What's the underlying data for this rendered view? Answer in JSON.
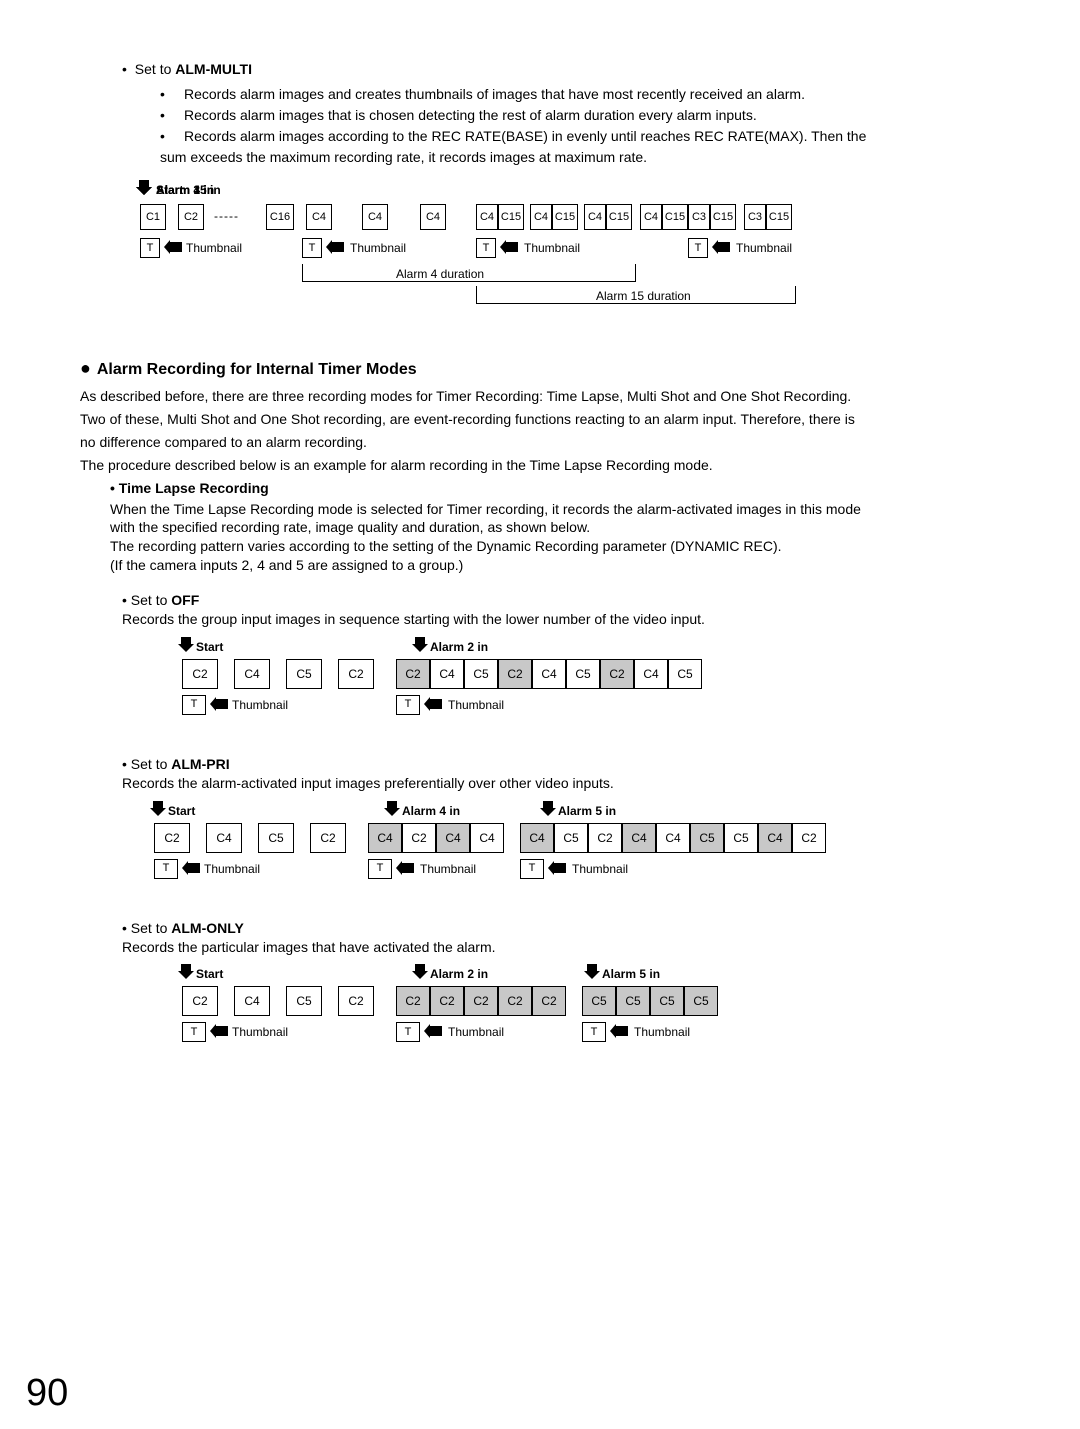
{
  "page_number": "90",
  "alm_multi": {
    "lead_prefix": "Set to ",
    "lead_bold": "ALM-MULTI",
    "bullets": [
      "Records alarm images and creates thumbnails of images that have most recently received an alarm.",
      "Records alarm images that is chosen detecting the rest of alarm duration every alarm inputs.",
      "Records alarm images according to the REC RATE(BASE) in evenly until reaches REC RATE(MAX). Then the"
    ],
    "sum_line": "sum exceeds the maximum recording rate, it records images at maximum rate."
  },
  "d1": {
    "events": [
      "Start",
      "Alarm 4 in",
      "Alarm 15 in",
      "Alarm 3 in"
    ],
    "row1_cells": [
      "C1",
      "C2",
      "C16",
      "C4",
      "C4",
      "C4",
      "C4",
      "C15",
      "C4",
      "C15",
      "C4",
      "C15",
      "C4",
      "C15",
      "C3",
      "C15",
      "C3",
      "C15"
    ],
    "t_label": "T",
    "thumbnail": "Thumbnail",
    "alarm4_dur": "Alarm 4 duration",
    "alarm15_dur": "Alarm 15 duration"
  },
  "section2": {
    "title": "Alarm Recording for Internal Timer Modes",
    "p1": "As described before, there are three recording modes for Timer Recording: Time Lapse, Multi Shot and One Shot Recording.",
    "p2": "Two of these, Multi Shot and One Shot recording, are event-recording functions reacting to an alarm input. Therefore, there is",
    "p3": "no difference compared to an alarm recording.",
    "p4": "The procedure described below is an example for alarm recording in the Time Lapse Recording mode."
  },
  "tlr": {
    "head": "Time Lapse Recording",
    "p1": "When the Time Lapse Recording mode is selected for Timer recording, it records the alarm-activated images in this mode",
    "p2": "with the specified recording rate, image quality and duration, as shown below.",
    "p3": "The recording pattern varies according to the setting of the Dynamic Recording parameter (DYNAMIC REC).",
    "p4": "(If the camera inputs 2, 4 and 5 are assigned to a group.)"
  },
  "off": {
    "lead_prefix": "Set to ",
    "lead_bold": "OFF",
    "desc": "Records the group input images in sequence starting with the lower number of the video input.",
    "events": [
      "Start",
      "Alarm 2 in"
    ],
    "cells_pre": [
      "C2",
      "C4",
      "C5",
      "C2"
    ],
    "cells_post": [
      "C2",
      "C4",
      "C5",
      "C2",
      "C4",
      "C5",
      "C2",
      "C4",
      "C5"
    ],
    "thumbnail": "Thumbnail",
    "t_label": "T"
  },
  "pri": {
    "lead_prefix": "Set to ",
    "lead_bold": "ALM-PRI",
    "desc": "Records the alarm-activated input images preferentially over other video inputs.",
    "events": [
      "Start",
      "Alarm 4 in",
      "Alarm 5 in"
    ],
    "cells_pre": [
      "C2",
      "C4",
      "C5",
      "C2"
    ],
    "cells_a": [
      "C4",
      "C2",
      "C4",
      "C4"
    ],
    "cells_b": [
      "C4",
      "C5",
      "C2",
      "C4",
      "C4",
      "C5",
      "C5",
      "C4",
      "C2"
    ],
    "thumbnail": "Thumbnail",
    "t_label": "T"
  },
  "only": {
    "lead_prefix": "Set to ",
    "lead_bold": "ALM-ONLY",
    "desc": "Records the particular images that have activated the alarm.",
    "events": [
      "Start",
      "Alarm 2 in",
      "Alarm 5 in"
    ],
    "cells_pre": [
      "C2",
      "C4",
      "C5",
      "C2"
    ],
    "cells_a": [
      "C2",
      "C2",
      "C2",
      "C2",
      "C2"
    ],
    "cells_b": [
      "C5",
      "C5",
      "C5",
      "C5"
    ],
    "thumbnail": "Thumbnail",
    "t_label": "T"
  }
}
